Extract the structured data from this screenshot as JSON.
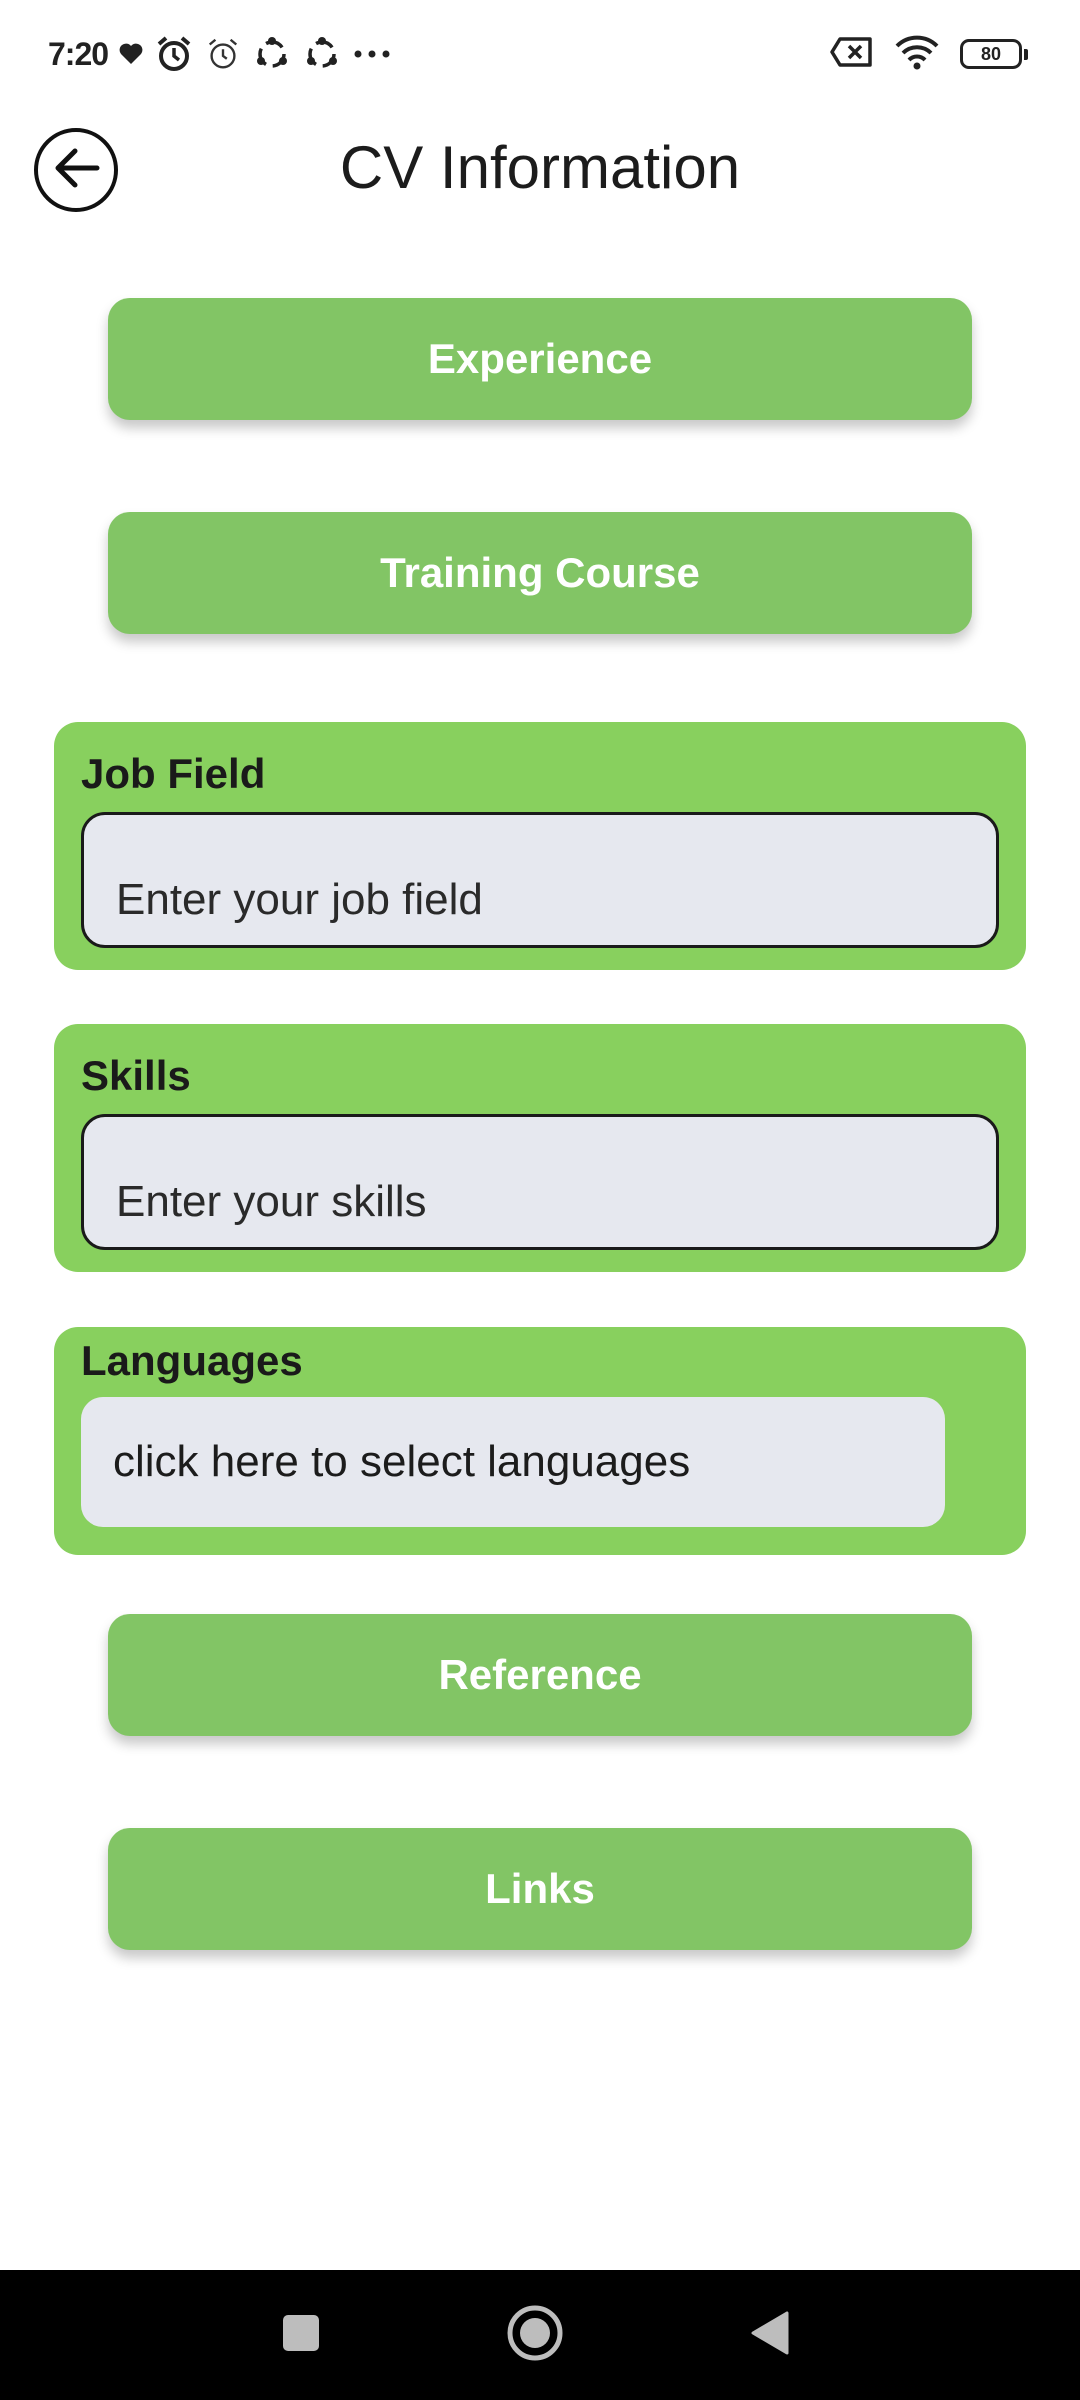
{
  "status_bar": {
    "time": "7:20",
    "battery_level": "80",
    "icons": [
      "heart-icon",
      "alarm-icon",
      "alarm-outline-icon",
      "sync-icon",
      "sync-icon",
      "more-dots-icon",
      "no-sim-icon",
      "wifi-icon",
      "battery-icon"
    ]
  },
  "header": {
    "title": "CV Information",
    "back_icon": "arrow-left-circle-icon"
  },
  "buttons": {
    "experience": "Experience",
    "training_course": "Training Course",
    "reference": "Reference",
    "links": "Links"
  },
  "fields": {
    "job_field": {
      "label": "Job Field",
      "placeholder": "Enter your job field",
      "value": ""
    },
    "skills": {
      "label": "Skills",
      "placeholder": "Enter your skills",
      "value": ""
    },
    "languages": {
      "label": "Languages",
      "selector_text": "click here to select languages"
    }
  },
  "nav_bar": {
    "items": [
      "recent-apps-icon",
      "home-icon",
      "back-icon"
    ]
  },
  "colors": {
    "button_green": "#82c565",
    "card_green": "#88d05e",
    "input_bg": "#e6e8ef",
    "nav_bg": "#000000"
  }
}
